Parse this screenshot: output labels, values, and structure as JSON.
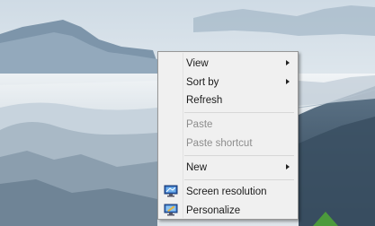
{
  "context_menu": {
    "items": [
      {
        "label": "View",
        "has_submenu": true,
        "enabled": true
      },
      {
        "label": "Sort by",
        "has_submenu": true,
        "enabled": true
      },
      {
        "label": "Refresh",
        "has_submenu": false,
        "enabled": true
      },
      {
        "label": "Paste",
        "has_submenu": false,
        "enabled": false
      },
      {
        "label": "Paste shortcut",
        "has_submenu": false,
        "enabled": false
      },
      {
        "label": "New",
        "has_submenu": true,
        "enabled": true
      },
      {
        "label": "Screen resolution",
        "has_submenu": false,
        "enabled": true,
        "icon": "monitor-resolution-icon"
      },
      {
        "label": "Personalize",
        "has_submenu": false,
        "enabled": true,
        "icon": "monitor-personalize-icon"
      }
    ]
  },
  "colors": {
    "menu_background": "#f0f0f0",
    "menu_border": "#979797",
    "disabled_text": "#8d8d8d"
  }
}
